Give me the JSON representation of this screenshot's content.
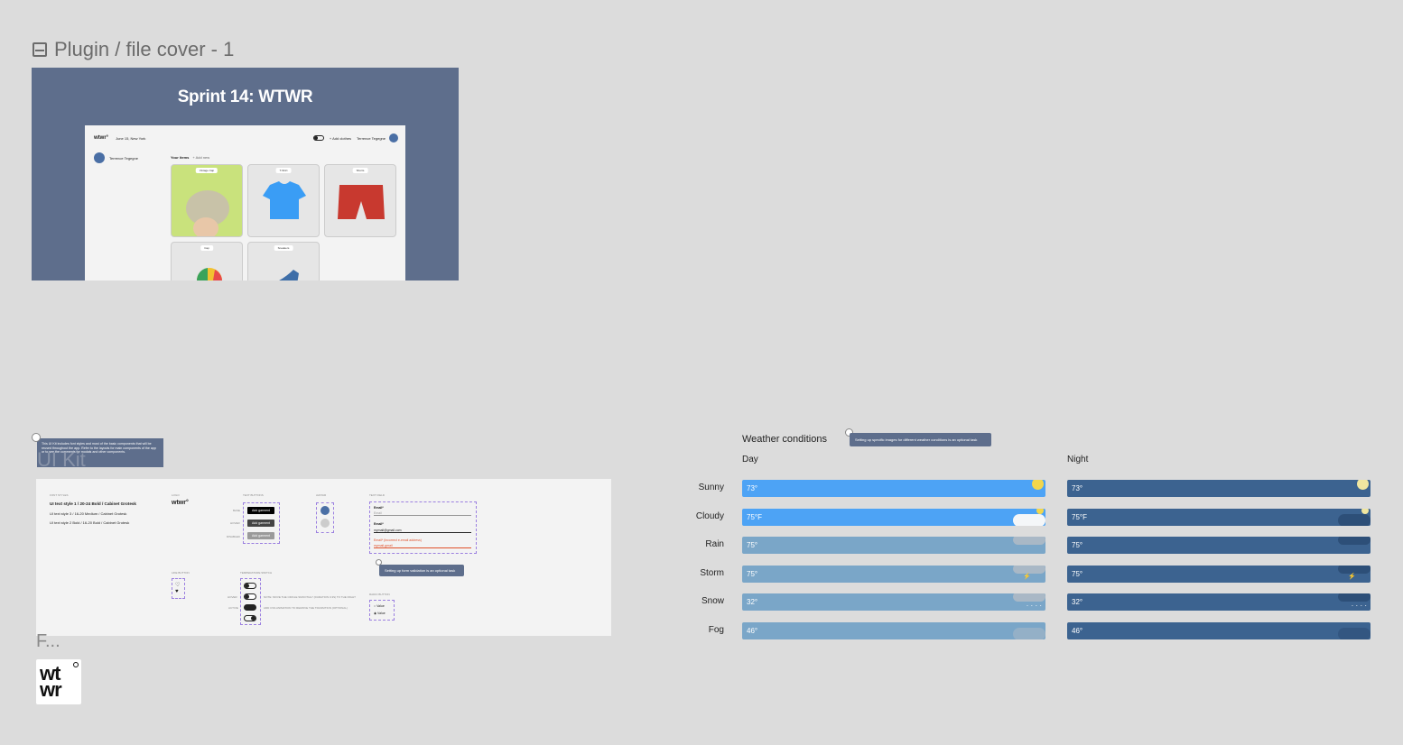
{
  "cover_frame": {
    "label": "Plugin / file cover - 1",
    "title": "Sprint 14: WTWR",
    "mock": {
      "logo": "wtwr°",
      "date_location": "June 15, New York",
      "add_clothes": "+ Add clothes",
      "user_name": "Terrence Tegegne",
      "your_items": "Your items",
      "add_new": "+ Add new",
      "cards": [
        "Vintage Cap",
        "T-Shirt",
        "Shorts",
        "Cap",
        "Sneakers"
      ]
    }
  },
  "ui_kit": {
    "label": "UI Kit",
    "note": "This UI Kit includes font styles and most of the basic components that will be reused throughout the app. Refer to the layouts for main components of the app or to see the comments for modals and other components.",
    "sections": {
      "font_styles": "Font styles",
      "logo": "Logo",
      "buttons": "Text buttons",
      "avatar": "Avatar",
      "text_field": "Text field",
      "like_button": "Like button",
      "temperature_switch": "Temperature switch",
      "radio": "Radio button"
    },
    "font_lines": [
      "UI text style 1 / 20-24 Bold / Cabinet Grotesk",
      "UI text style 3 / 16-20 Medium / Cabinet Grotesk",
      "UI text style 2 Bold / 16-20 Bold / Cabinet Grotesk"
    ],
    "logo_text": "wtwr°",
    "button_states": [
      "Base",
      "Hover",
      "Disabled"
    ],
    "button_label": "Add garment",
    "email_label": "Email*",
    "email_placeholder": "Email",
    "email_value": "mymail@gmail.com",
    "email_error": "Email* (Incorrect e-email address)",
    "email_error_value": "mymail-gmail",
    "validation_tip": "Setting up form validation is an optional task",
    "switch_states": [
      "Hover",
      "Active"
    ],
    "switch_notes": [
      "Note: move the circle smoothly (duration 0.3s) to the right",
      "Add css animation to remove the transition (optional)"
    ],
    "radio_options": [
      "Value",
      "Value"
    ],
    "f_label": "F...",
    "logo_box_text": [
      "wt",
      "wr"
    ]
  },
  "weather": {
    "title": "Weather conditions",
    "tip": "Setting up specific images for different weather conditions is an optional task",
    "day_label": "Day",
    "night_label": "Night",
    "rows": [
      {
        "name": "Sunny",
        "day": "73°",
        "night": "73°",
        "day_color": "#4da3f5",
        "night_color": "#3c6390"
      },
      {
        "name": "Cloudy",
        "day": "75°F",
        "night": "75°F",
        "day_color": "#4da3f5",
        "night_color": "#3c6390"
      },
      {
        "name": "Rain",
        "day": "75°",
        "night": "75°",
        "day_color": "#7aa6c8",
        "night_color": "#3c6390"
      },
      {
        "name": "Storm",
        "day": "75°",
        "night": "75°",
        "day_color": "#7aa6c8",
        "night_color": "#3c6390"
      },
      {
        "name": "Snow",
        "day": "32°",
        "night": "32°",
        "day_color": "#7aa6c8",
        "night_color": "#3c6390"
      },
      {
        "name": "Fog",
        "day": "46°",
        "night": "46°",
        "day_color": "#7aa6c8",
        "night_color": "#3c6390"
      }
    ]
  },
  "colors": {
    "canvas": "#dcdcdc",
    "cover_bg": "#5e6e8c",
    "accent_day": "#4da3f5",
    "accent_night": "#3c6390"
  }
}
